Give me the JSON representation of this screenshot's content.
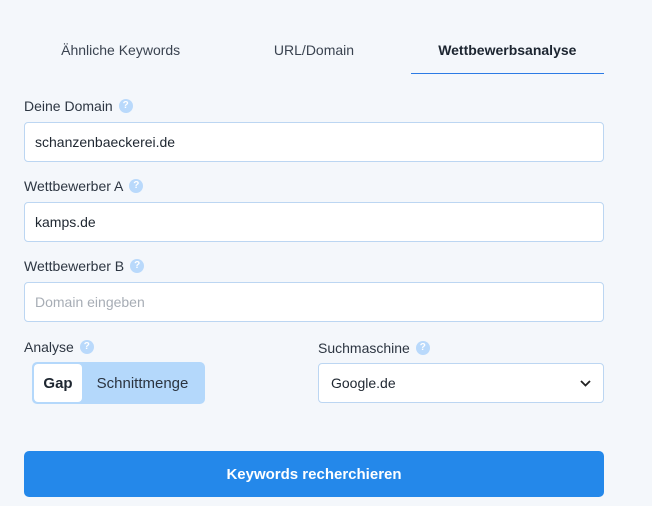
{
  "tabs": [
    {
      "label": "Ähnliche Keywords"
    },
    {
      "label": "URL/Domain"
    },
    {
      "label": "Wettbewerbsanalyse"
    }
  ],
  "form": {
    "domain": {
      "label": "Deine Domain",
      "value": "schanzenbaeckerei.de"
    },
    "competitor_a": {
      "label": "Wettbewerber A",
      "value": "kamps.de"
    },
    "competitor_b": {
      "label": "Wettbewerber B",
      "placeholder": "Domain eingeben"
    },
    "analysis": {
      "label": "Analyse",
      "options": [
        "Gap",
        "Schnittmenge"
      ],
      "selected": "Gap"
    },
    "search_engine": {
      "label": "Suchmaschine",
      "value": "Google.de"
    },
    "help_glyph": "?",
    "select_glyph": "⌄"
  },
  "submit_label": "Keywords recherchieren",
  "colors": {
    "accent": "#2488ea",
    "toggle_bg": "#b4d8fb",
    "help_icon": "#b9d9fb"
  }
}
